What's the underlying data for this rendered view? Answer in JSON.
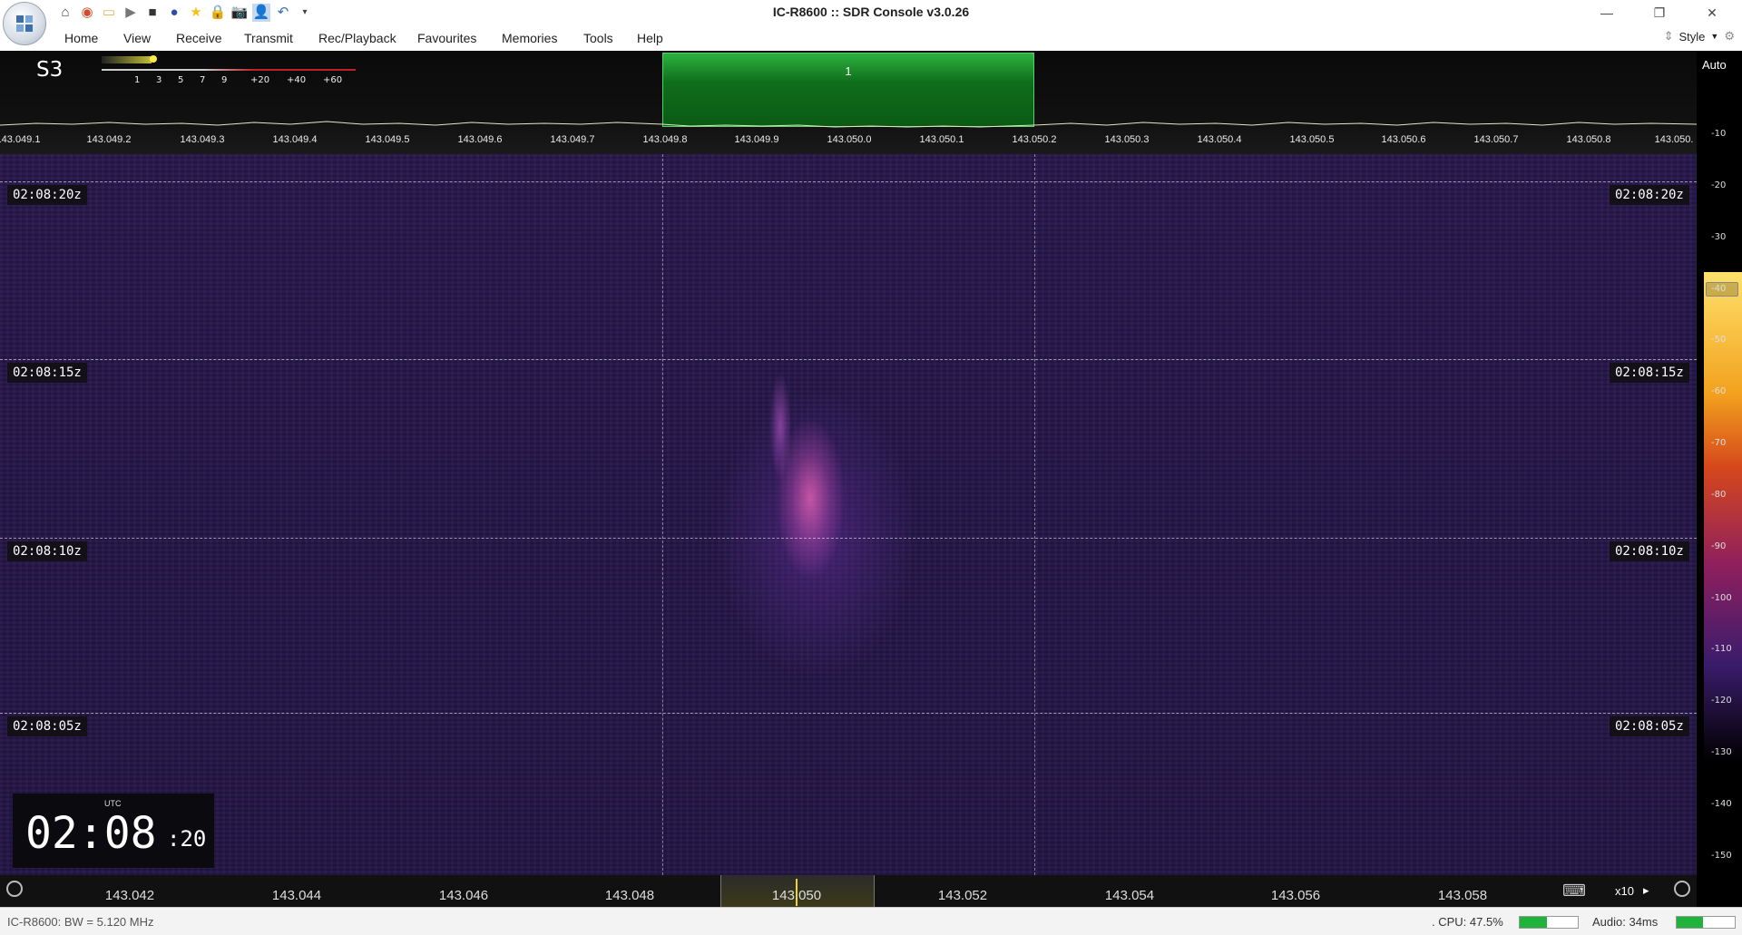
{
  "window": {
    "title": "IC-R8600 :: SDR Console v3.0.26",
    "minimize": "—",
    "restore": "❐",
    "close": "✕"
  },
  "quick_access": [
    {
      "name": "home-icon",
      "glyph": "⌂"
    },
    {
      "name": "lifebuoy-icon",
      "glyph": "◉"
    },
    {
      "name": "folder-icon",
      "glyph": "▭"
    },
    {
      "name": "play-icon",
      "glyph": "▶"
    },
    {
      "name": "stop-icon",
      "glyph": "■"
    },
    {
      "name": "record-icon",
      "glyph": "●"
    },
    {
      "name": "star-icon",
      "glyph": "★"
    },
    {
      "name": "lock-icon",
      "glyph": "🔒"
    },
    {
      "name": "camera-icon",
      "glyph": "📷"
    },
    {
      "name": "person-icon",
      "glyph": "👤"
    },
    {
      "name": "undo-icon",
      "glyph": "↶"
    },
    {
      "name": "customize-icon",
      "glyph": "▾"
    }
  ],
  "menu": [
    "Home",
    "View",
    "Receive",
    "Transmit",
    "Rec/Playback",
    "Favourites",
    "Memories",
    "Tools",
    "Help"
  ],
  "style_label": "Style",
  "smeter": {
    "reading": "S3",
    "scale": [
      "1",
      "3",
      "5",
      "7",
      "9",
      "+20",
      "+40",
      "+60"
    ]
  },
  "vfo": {
    "label": "1"
  },
  "spectrum_auto": "Auto",
  "spectrum_ticks": [
    "143.049.1",
    "143.049.2",
    "143.049.3",
    "143.049.4",
    "143.049.5",
    "143.049.6",
    "143.049.7",
    "143.049.8",
    "143.049.9",
    "143.050.0",
    "143.050.1",
    "143.050.2",
    "143.050.3",
    "143.050.4",
    "143.050.5",
    "143.050.6",
    "143.050.7",
    "143.050.8",
    "143.050."
  ],
  "waterfall_times": [
    "02:08:20z",
    "02:08:15z",
    "02:08:10z",
    "02:08:05z"
  ],
  "clock": {
    "utc": "UTC",
    "hm": "02:08",
    "sec": ":20"
  },
  "db_scale": [
    "-10",
    "-20",
    "-30",
    "-40",
    "-50",
    "-60",
    "-70",
    "-80",
    "-90",
    "-100",
    "-110",
    "-120",
    "-130",
    "-140",
    "-150"
  ],
  "bottom_ruler": [
    "143.042",
    "143.044",
    "143.046",
    "143.048",
    "143.050",
    "143.052",
    "143.054",
    "143.056",
    "143.058"
  ],
  "zoom": {
    "keyboard_icon": "⌨",
    "factor": "x10",
    "arrow": "▸"
  },
  "status": {
    "device": "IC-R8600: BW = 5.120 MHz",
    "cpu": ". CPU: 47.5%",
    "cpu_level": 0.475,
    "audio": "Audio: 34ms",
    "audio_level": 0.45
  }
}
